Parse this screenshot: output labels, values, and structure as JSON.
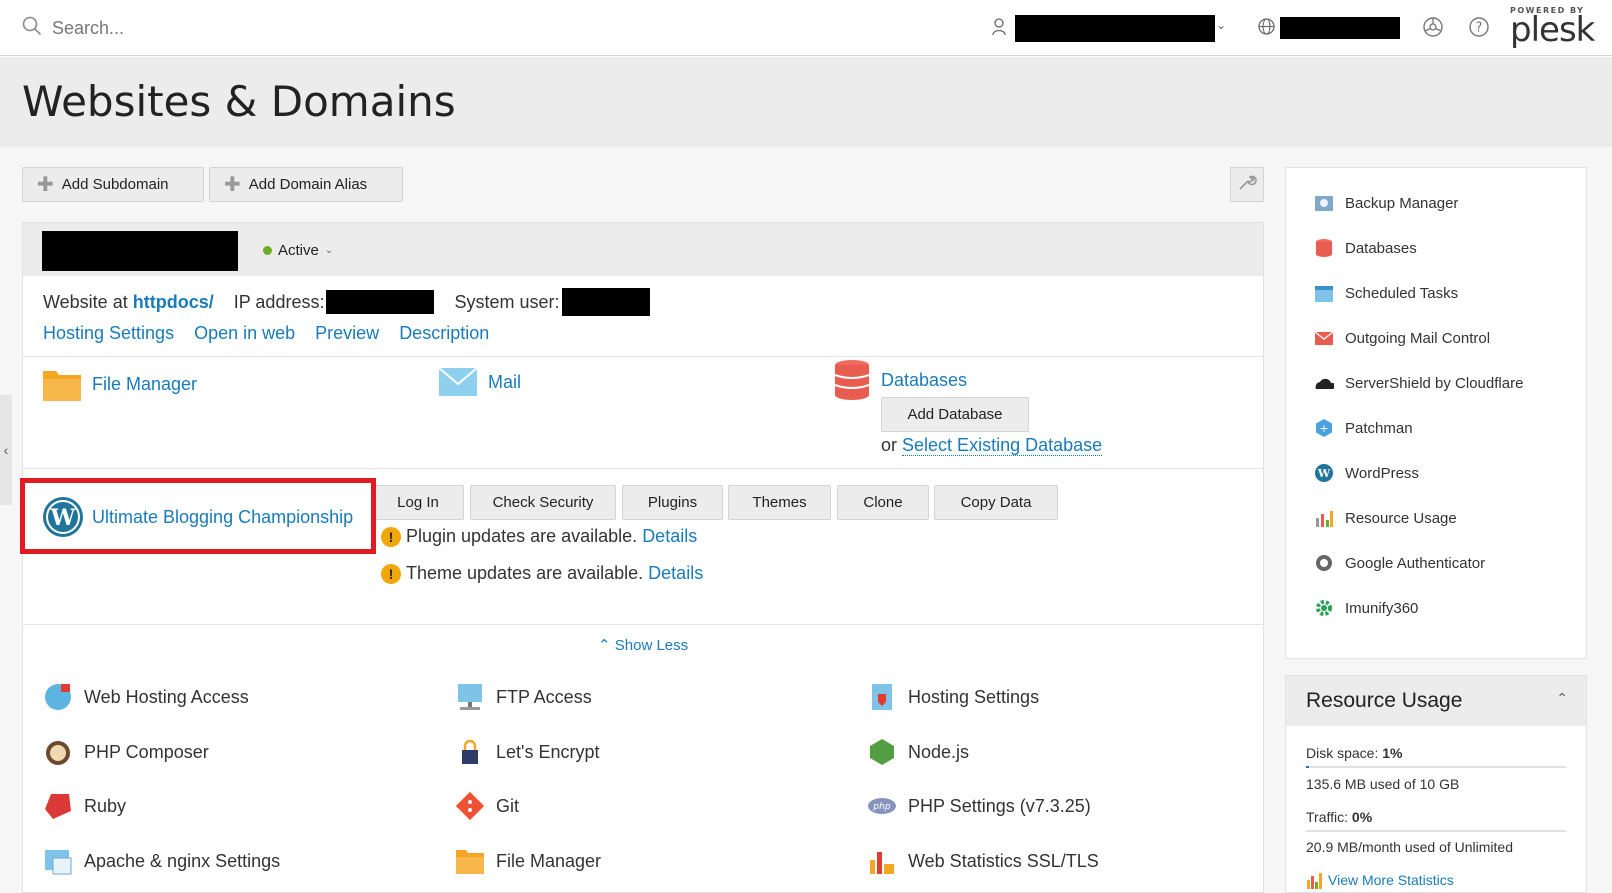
{
  "topbar": {
    "search_placeholder": "Search...",
    "plesk_powered": "POWERED BY",
    "plesk_logo": "plesk"
  },
  "page": {
    "title": "Websites & Domains"
  },
  "toolbar": {
    "add_subdomain": "Add Subdomain",
    "add_domain_alias": "Add Domain Alias"
  },
  "domain": {
    "status": "Active",
    "website_at_label": "Website at",
    "website_path": "httpdocs/",
    "ip_label": "IP address:",
    "user_label": "System user:",
    "links": [
      "Hosting Settings",
      "Open in web",
      "Preview",
      "Description"
    ]
  },
  "tools": {
    "file_manager": "File Manager",
    "mail": "Mail",
    "databases": "Databases",
    "add_database": "Add Database",
    "or": "or",
    "select_existing_db": "Select Existing Database"
  },
  "wordpress": {
    "site_name": "Ultimate Blogging Championship",
    "actions": [
      "Log In",
      "Check Security",
      "Plugins",
      "Themes",
      "Clone",
      "Copy Data"
    ],
    "plugin_notice": "Plugin updates are available.",
    "theme_notice": "Theme updates are available.",
    "details": "Details"
  },
  "show_less": "Show Less",
  "grid_tools": [
    [
      "Web Hosting Access",
      "FTP Access",
      "Hosting Settings"
    ],
    [
      "PHP Composer",
      "Let's Encrypt",
      "Node.js"
    ],
    [
      "Ruby",
      "Git",
      "PHP Settings (v7.3.25)"
    ],
    [
      "Apache & nginx Settings",
      "File Manager",
      "Web Statistics SSL/TLS"
    ]
  ],
  "sidebar": {
    "items": [
      "Backup Manager",
      "Databases",
      "Scheduled Tasks",
      "Outgoing Mail Control",
      "ServerShield by Cloudflare",
      "Patchman",
      "WordPress",
      "Resource Usage",
      "Google Authenticator",
      "Imunify360"
    ]
  },
  "resource_usage": {
    "title": "Resource Usage",
    "disk_label": "Disk space:",
    "disk_pct": "1%",
    "disk_fraction": 0.01,
    "disk_detail": "135.6 MB used of 10 GB",
    "traffic_label": "Traffic:",
    "traffic_pct": "0%",
    "traffic_fraction": 0.0,
    "traffic_detail": "20.9 MB/month used of Unlimited",
    "view_more": "View More Statistics"
  },
  "colors": {
    "accent": "#1a7bb9",
    "highlight": "#e01b24",
    "active": "#6aae27",
    "warning": "#f0a70a"
  }
}
